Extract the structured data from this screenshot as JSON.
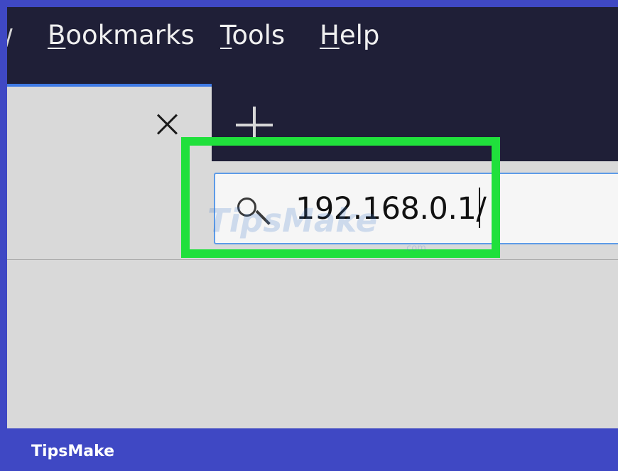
{
  "menubar": {
    "items": [
      {
        "prefix": "",
        "mnemonic": "B",
        "rest": "ookmarks"
      },
      {
        "prefix": "",
        "mnemonic": "T",
        "rest": "ools"
      },
      {
        "prefix": "",
        "mnemonic": "H",
        "rest": "elp"
      }
    ]
  },
  "tabstrip": {
    "close_icon": "close-icon",
    "new_tab_icon": "plus-icon"
  },
  "address_bar": {
    "icon": "search-icon",
    "value": "192.168.0.1/"
  },
  "watermark": {
    "brand": "TipsMake",
    "suffix": ".com"
  },
  "footer": {
    "brand": "TipsMake"
  },
  "colors": {
    "background_blue": "#3f48c4",
    "menubar_dark": "#1f1f37",
    "content_gray": "#d9d9d9",
    "address_border_blue": "#5d9be8",
    "highlight_green": "#20e03c",
    "footer_text": "#ffffff"
  }
}
